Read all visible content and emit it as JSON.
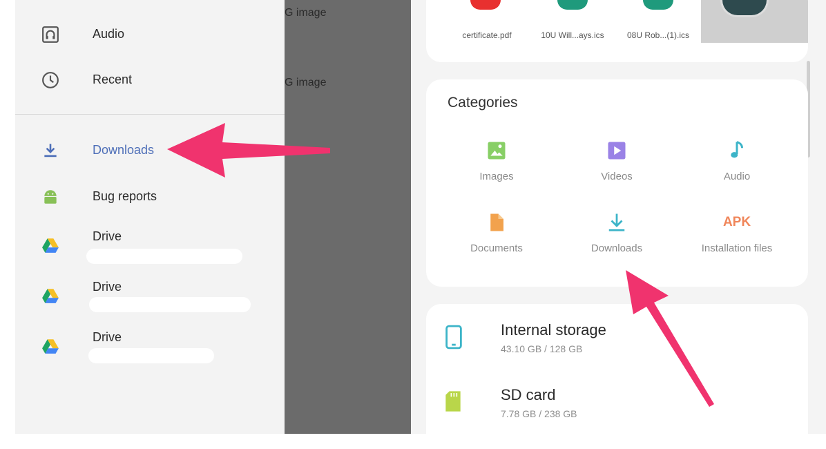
{
  "drawer": {
    "items": [
      {
        "label": "Audio",
        "icon": "audio-icon"
      },
      {
        "label": "Recent",
        "icon": "clock-icon"
      },
      {
        "label": "Downloads",
        "icon": "download-icon",
        "active": true
      },
      {
        "label": "Bug reports",
        "icon": "android-icon"
      },
      {
        "label": "Drive",
        "icon": "drive-icon"
      },
      {
        "label": "Drive",
        "icon": "drive-icon"
      },
      {
        "label": "Drive",
        "icon": "drive-icon"
      }
    ]
  },
  "scrim": {
    "line1": "G image",
    "line2": "G image"
  },
  "recent_files": [
    {
      "name": "certificate.pdf"
    },
    {
      "name": "10U Will...ays.ics"
    },
    {
      "name": "08U Rob...(1).ics"
    }
  ],
  "categories": {
    "title": "Categories",
    "items": [
      {
        "label": "Images",
        "icon": "image-icon"
      },
      {
        "label": "Videos",
        "icon": "video-icon"
      },
      {
        "label": "Audio",
        "icon": "music-note-icon"
      },
      {
        "label": "Documents",
        "icon": "document-icon"
      },
      {
        "label": "Downloads",
        "icon": "download-icon"
      },
      {
        "label": "Installation files",
        "icon_text": "APK"
      }
    ]
  },
  "storage": [
    {
      "title": "Internal storage",
      "usage": "43.10 GB / 128 GB",
      "icon": "phone-icon"
    },
    {
      "title": "SD card",
      "usage": "7.78 GB / 238 GB",
      "icon": "sd-card-icon"
    }
  ],
  "colors": {
    "accent_arrow": "#f0336e",
    "active_blue": "#4e6fb8",
    "green": "#88cf66",
    "purple": "#9a82e6",
    "teal": "#3cb4c8",
    "orange": "#f2a24d"
  }
}
